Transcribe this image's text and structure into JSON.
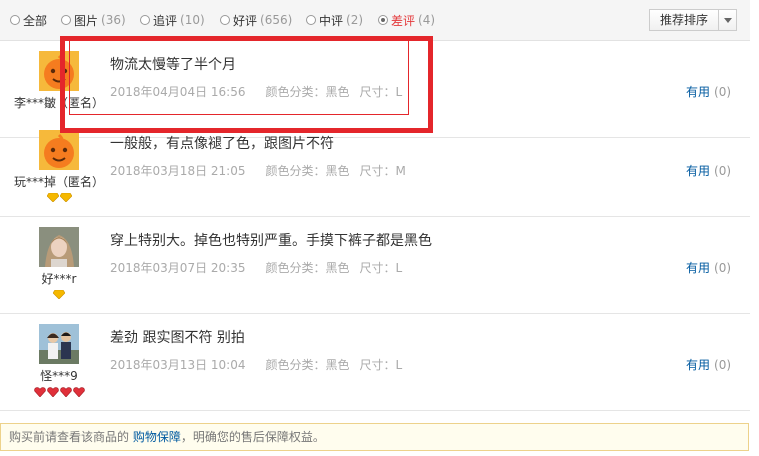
{
  "filters": [
    {
      "label": "全部",
      "count": "",
      "checked": false
    },
    {
      "label": "图片",
      "count": "(36)",
      "checked": false
    },
    {
      "label": "追评",
      "count": "(10)",
      "checked": false
    },
    {
      "label": "好评",
      "count": "(656)",
      "checked": false
    },
    {
      "label": "中评",
      "count": "(2)",
      "checked": false
    },
    {
      "label": "差评",
      "count": "(4)",
      "checked": true
    }
  ],
  "sort": {
    "label": "推荐排序"
  },
  "reviews": [
    {
      "user": "李***皺（匿名）",
      "text": "物流太慢等了半个月",
      "date": "2018年04月04日 16:56",
      "color": "颜色分类：黑色",
      "size": "尺寸：L",
      "useful_label": "有用",
      "useful_count": "(0)"
    },
    {
      "user": "玩***掉（匿名）",
      "text": "一般般，有点像褪了色，跟图片不符",
      "date": "2018年03月18日 21:05",
      "color": "颜色分类：黑色",
      "size": "尺寸：M",
      "useful_label": "有用",
      "useful_count": "(0)"
    },
    {
      "user": "好***r",
      "text": "穿上特别大。掉色也特别严重。手摸下裤子都是黑色",
      "date": "2018年03月07日 20:35",
      "color": "颜色分类：黑色",
      "size": "尺寸：L",
      "useful_label": "有用",
      "useful_count": "(0)"
    },
    {
      "user": "怪***9",
      "text": "差劲 跟实图不符 别拍",
      "date": "2018年03月13日 10:04",
      "color": "颜色分类：黑色",
      "size": "尺寸：L",
      "useful_label": "有用",
      "useful_count": "(0)"
    }
  ],
  "notice": {
    "before": "购买前请查看该商品的 ",
    "link": "购物保障",
    "after": "，明确您的售后保障权益。"
  },
  "colors": {
    "accent": "#e4393c",
    "link": "#005aa0",
    "highlight": "#e4262b",
    "notice_bg": "#fffdee"
  }
}
